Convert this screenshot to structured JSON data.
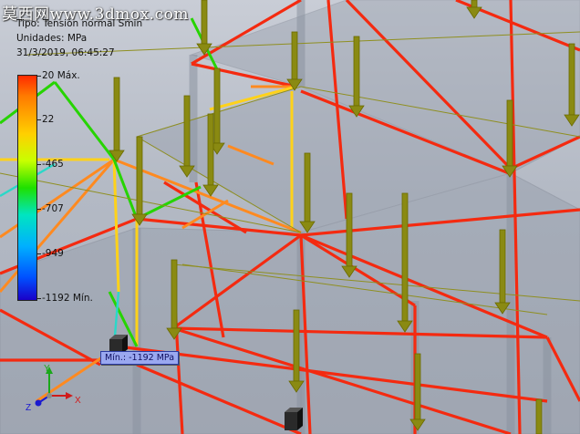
{
  "watermark": "莫西网www.3dmox.com",
  "result_info": {
    "type": "Tipo: Tensión normal Smin",
    "units": "Unidades: MPa",
    "timestamp": "31/3/2019, 06:45:27"
  },
  "legend": {
    "labels": [
      "20 Máx.",
      "22",
      "-465",
      "-707",
      "-949",
      "-1192 Mín."
    ]
  },
  "probe": {
    "label": "Mín.: -1192 MPa"
  },
  "triad": {
    "x_label": "X",
    "y_label": "Y",
    "z_label": "Z"
  },
  "colors": {
    "high_stress": "#ff2a00",
    "mid_stress": "#ffd000",
    "low_stress": "#1fe000",
    "load_arrow": "#8a8a10",
    "probe_bg": "#9aa8f0"
  }
}
